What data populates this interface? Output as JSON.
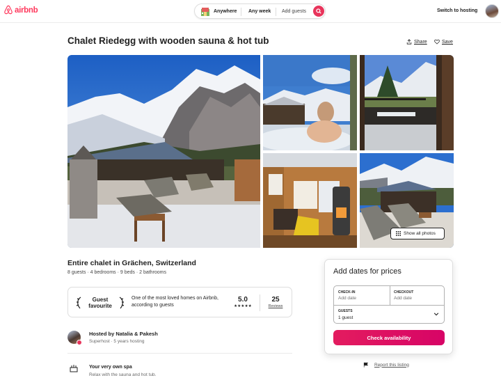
{
  "header": {
    "brand": "airbnb",
    "search": {
      "anywhere": "Anywhere",
      "any_week": "Any week",
      "add_guests": "Add guests"
    },
    "switch_to_hosting": "Switch to hosting"
  },
  "listing": {
    "title": "Chalet Riedegg with wooden sauna & hot tub",
    "share_label": "Share",
    "save_label": "Save",
    "show_all_photos": "Show all photos",
    "subtitle": "Entire chalet in Grächen, Switzerland",
    "details": "8 guests · 4 bedrooms · 9 beds · 2 bathrooms"
  },
  "guest_favourite": {
    "badge_line1": "Guest",
    "badge_line2": "favourite",
    "description": "One of the most loved homes on Airbnb, according to guests",
    "rating": "5.0",
    "stars": "★★★★★",
    "reviews_count": "25",
    "reviews_label": "Reviews"
  },
  "host": {
    "hosted_by": "Hosted by Natalia & Pakesh",
    "subtext": "Superhost · 5 years hosting"
  },
  "highlights": [
    {
      "title": "Your very own spa",
      "description": "Relax with the sauna and hot tub."
    }
  ],
  "booking": {
    "title": "Add dates for prices",
    "checkin_label": "CHECK-IN",
    "checkin_placeholder": "Add date",
    "checkout_label": "CHECKOUT",
    "checkout_placeholder": "Add date",
    "guests_label": "GUESTS",
    "guests_value": "1 guest",
    "button": "Check availability",
    "report": "Report this listing"
  },
  "colors": {
    "brand": "#ff385c",
    "button": "#e31c5f"
  }
}
